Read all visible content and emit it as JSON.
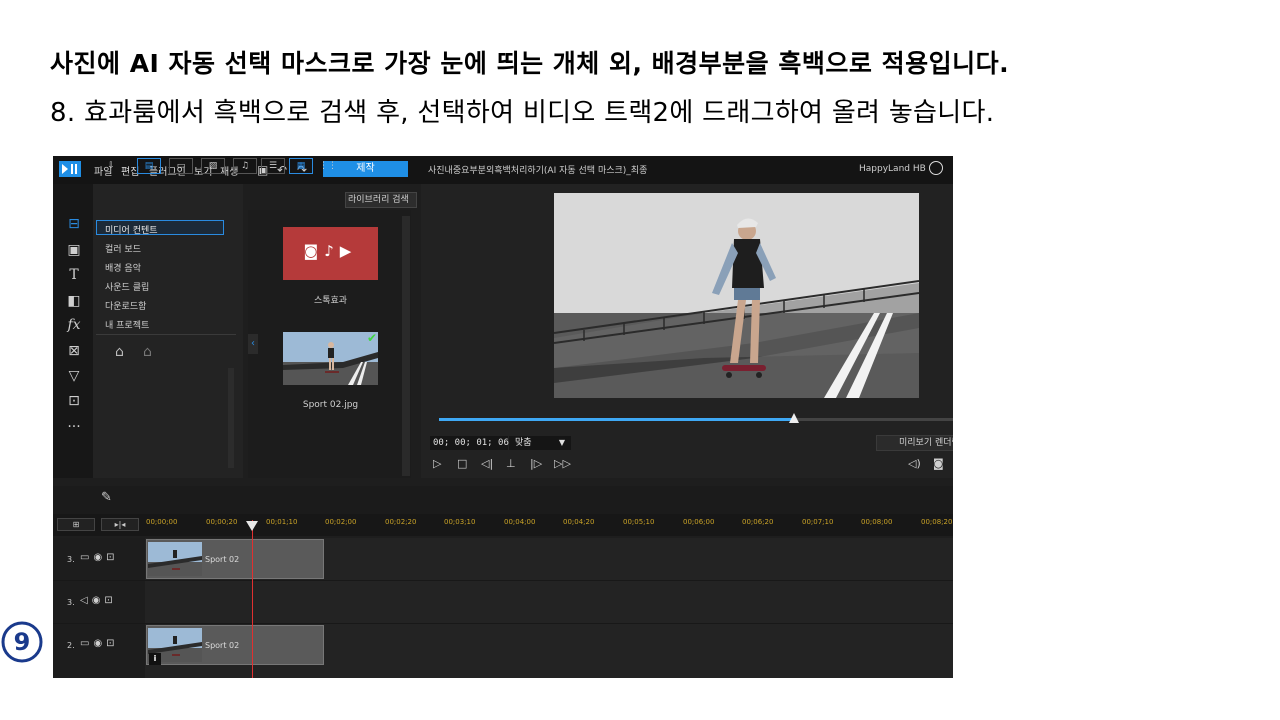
{
  "slide": {
    "heading": "사진에 AI 자동 선택 마스크로 가장 눈에 띄는 개체 외, 배경부분을 흑백으로 적용입니다.",
    "step_text": "8. 효과룸에서 흑백으로 검색 후, 선택하여 비디오 트랙2에 드래그하여 올려 놓습니다.",
    "step_number": "9"
  },
  "app": {
    "menu": [
      "파일",
      "편집",
      "플러그인",
      "보기",
      "재생"
    ],
    "produce_label": "제작",
    "project_title": "사진내중요부분외흑백처리하기(AI 자동 선택 마스크)_최종",
    "user": "HappyLand HB",
    "library": {
      "search_placeholder": "라이브러리 검색",
      "items": [
        "미디어 컨텐트",
        "컬러 보드",
        "배경 음악",
        "사운드 클립",
        "다운로드함",
        "내 프로젝트"
      ],
      "selected_index": 0
    },
    "media": {
      "stock_label": "스톡효과",
      "clip_label": "Sport 02.jpg"
    },
    "preview": {
      "timecode": "00; 00; 01; 06",
      "fit_label": "맞춤",
      "preview_quality": "미리보기 렌더링",
      "scrub_progress": 0.69
    },
    "timeline": {
      "ticks": [
        "00;00;00",
        "00;00;20",
        "00;01;10",
        "00;02;00",
        "00;02;20",
        "00;03;10",
        "00;04;00",
        "00;04;20",
        "00;05;10",
        "00;06;00",
        "00;06;20",
        "00;07;10",
        "00;08;00",
        "00;08;20"
      ],
      "tracks": [
        {
          "label": "3.",
          "type": "video",
          "clip": "Sport 02"
        },
        {
          "label": "3.",
          "type": "audio",
          "clip": ""
        },
        {
          "label": "2.",
          "type": "video",
          "clip": "Sport 02"
        }
      ]
    }
  },
  "colors": {
    "accent": "#1f8fe6",
    "stock_tile": "#b53a3a",
    "playhead": "#e03030",
    "scrub": "#3fa9f5"
  }
}
